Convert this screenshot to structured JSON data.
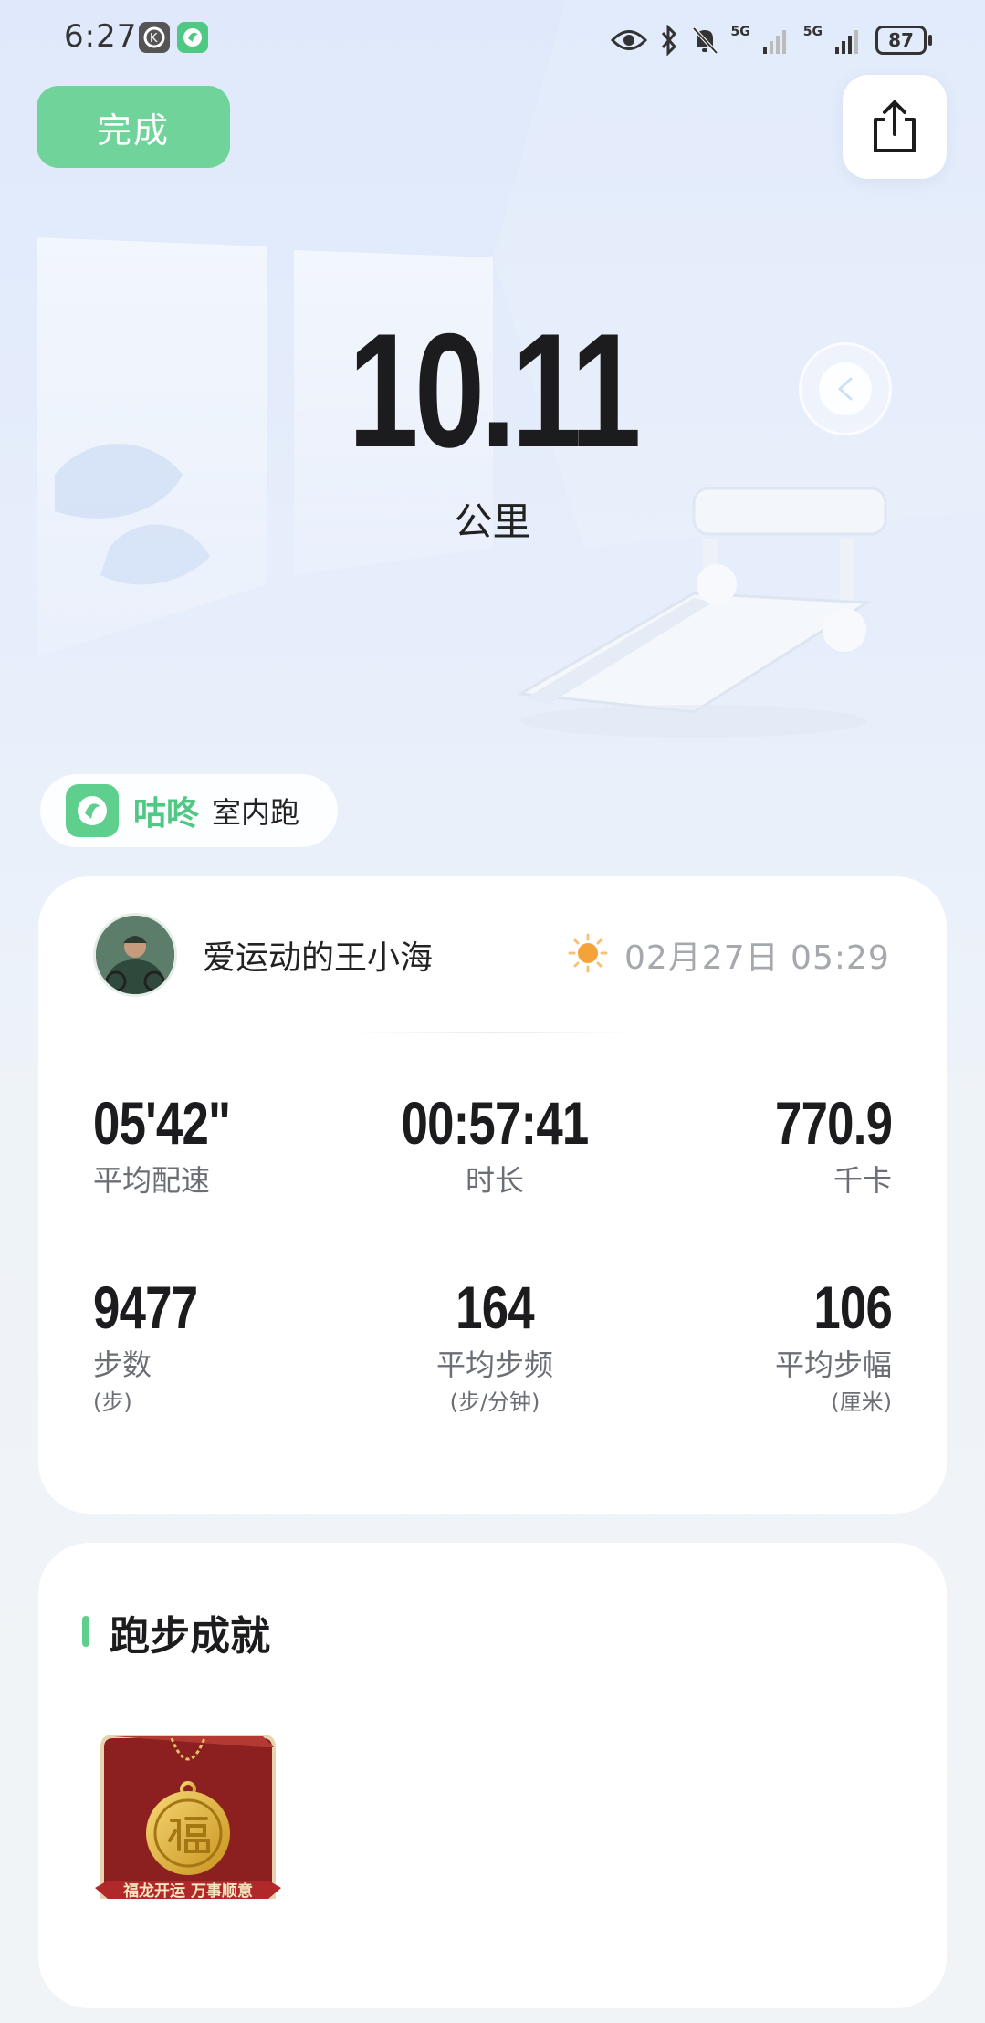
{
  "status_bar": {
    "time": "6:27",
    "signal_1": "5G",
    "signal_2": "5G",
    "battery": "87"
  },
  "header": {
    "done_label": "完成"
  },
  "hero": {
    "distance": "10.11",
    "unit": "公里"
  },
  "brand": {
    "name": "咕咚",
    "activity_type": "室内跑",
    "color": "#5fcf8d"
  },
  "record": {
    "user_name": "爱运动的王小海",
    "datetime": "02月27日 05:29",
    "weather_icon": "sun-icon",
    "stats": [
      {
        "value": "05'42\"",
        "label": "平均配速",
        "sub": ""
      },
      {
        "value": "00:57:41",
        "label": "时长",
        "sub": ""
      },
      {
        "value": "770.9",
        "label": "千卡",
        "sub": ""
      },
      {
        "value": "9477",
        "label": "步数",
        "sub": "(步)"
      },
      {
        "value": "164",
        "label": "平均步频",
        "sub": "(步/分钟)"
      },
      {
        "value": "106",
        "label": "平均步幅",
        "sub": "(厘米)"
      }
    ]
  },
  "achievements": {
    "title": "跑步成就",
    "medal_caption": "福龙开运  万事顺意"
  }
}
